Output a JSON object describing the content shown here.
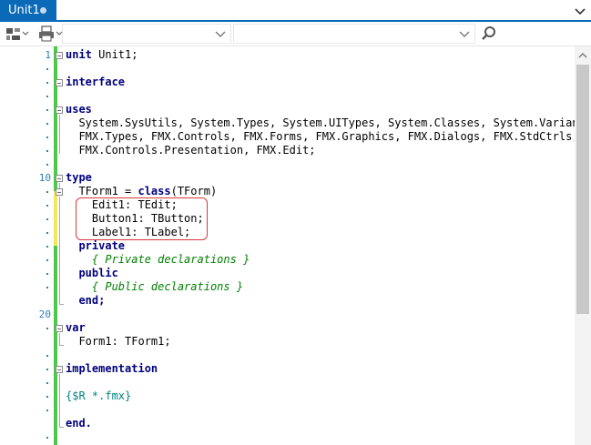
{
  "tab": {
    "title": "Unit1"
  },
  "toolbar": {
    "icons": [
      "structure-view-icon",
      "print-icon",
      "search-icon"
    ],
    "combo1_value": "",
    "combo2_value": ""
  },
  "colors": {
    "accent": "#0b6ab8",
    "line_numbers": "#2e7fb8",
    "keyword": "#000080",
    "comment": "#008000",
    "directive": "#008080",
    "highlight_border": "#d9383b",
    "modified_bar": "#f2e85c",
    "saved_bar": "#4cc94c"
  },
  "gutter": {
    "line_numbers": [
      "1",
      "10",
      "20"
    ]
  },
  "code": {
    "l1_kw": "unit",
    "l1_rest": " Unit1;",
    "l3_kw": "interface",
    "l5_kw": "uses",
    "l6": "  System.SysUtils, System.Types, System.UITypes, System.Classes, System.Variants,",
    "l7": "  FMX.Types, FMX.Controls, FMX.Forms, FMX.Graphics, FMX.Dialogs, FMX.StdCtrls,",
    "l8": "  FMX.Controls.Presentation, FMX.Edit;",
    "l10_kw": "type",
    "l11_a": "  TForm1 = ",
    "l11_kw": "class",
    "l11_b": "(TForm)",
    "l12": "    Edit1: TEdit;",
    "l13": "    Button1: TButton;",
    "l14": "    Label1: TLabel;",
    "l15_kw": "  private",
    "l16_cm": "    { Private declarations }",
    "l17_kw": "  public",
    "l18_cm": "    { Public declarations }",
    "l19_kw": "  end;",
    "l21_kw": "var",
    "l22": "  Form1: TForm1;",
    "l24_kw": "implementation",
    "l26_dir": "{$R *.fmx}",
    "l28_kw": "end."
  }
}
